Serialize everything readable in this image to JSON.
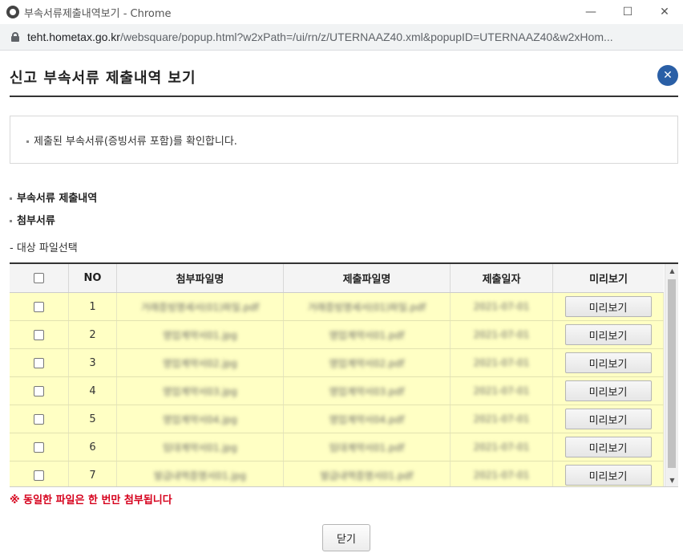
{
  "window": {
    "title": "부속서류제출내역보기 - Chrome",
    "controls": {
      "minimize": "—",
      "maximize": "☐",
      "close": "✕"
    }
  },
  "address": {
    "host": "teht.hometax.go.kr",
    "path": "/websquare/popup.html?w2xPath=/ui/rn/z/UTERNAAZ40.xml&popupID=UTERNAAZ40&w2xHom..."
  },
  "popup": {
    "title": "신고 부속서류 제출내역 보기",
    "close_icon": "✕"
  },
  "notice": "제출된 부속서류(증빙서류 포함)를 확인합니다.",
  "sections": {
    "submitted": "부속서류 제출내역",
    "attachments": "첨부서류",
    "target": "- 대상 파일선택"
  },
  "table": {
    "headers": {
      "no": "NO",
      "attach": "첨부파일명",
      "submit": "제출파일명",
      "date": "제출일자",
      "preview": "미리보기"
    },
    "rows": [
      {
        "no": "1",
        "attach": "거래증빙명세서(01)파일.pdf",
        "submit": "거래증빙명세서(01)파일.pdf",
        "date": "2021-07-01",
        "preview": "미리보기"
      },
      {
        "no": "2",
        "attach": "영업계약서01.jpg",
        "submit": "영업계약서01.pdf",
        "date": "2021-07-01",
        "preview": "미리보기"
      },
      {
        "no": "3",
        "attach": "영업계약서02.jpg",
        "submit": "영업계약서02.pdf",
        "date": "2021-07-01",
        "preview": "미리보기"
      },
      {
        "no": "4",
        "attach": "영업계약서03.jpg",
        "submit": "영업계약서03.pdf",
        "date": "2021-07-01",
        "preview": "미리보기"
      },
      {
        "no": "5",
        "attach": "영업계약서04.jpg",
        "submit": "영업계약서04.pdf",
        "date": "2021-07-01",
        "preview": "미리보기"
      },
      {
        "no": "6",
        "attach": "임대계약서01.jpg",
        "submit": "임대계약서01.pdf",
        "date": "2021-07-01",
        "preview": "미리보기"
      },
      {
        "no": "7",
        "attach": "발급내역증명서01.jpg",
        "submit": "발급내역증명서01.pdf",
        "date": "2021-07-01",
        "preview": "미리보기"
      }
    ]
  },
  "warning": "※ 동일한 파일은 한 번만 첨부됩니다",
  "close_button": "닫기",
  "colors": {
    "row_highlight": "#ffffc4",
    "warning": "#d6001c",
    "close_circle": "#2a5fa6"
  }
}
